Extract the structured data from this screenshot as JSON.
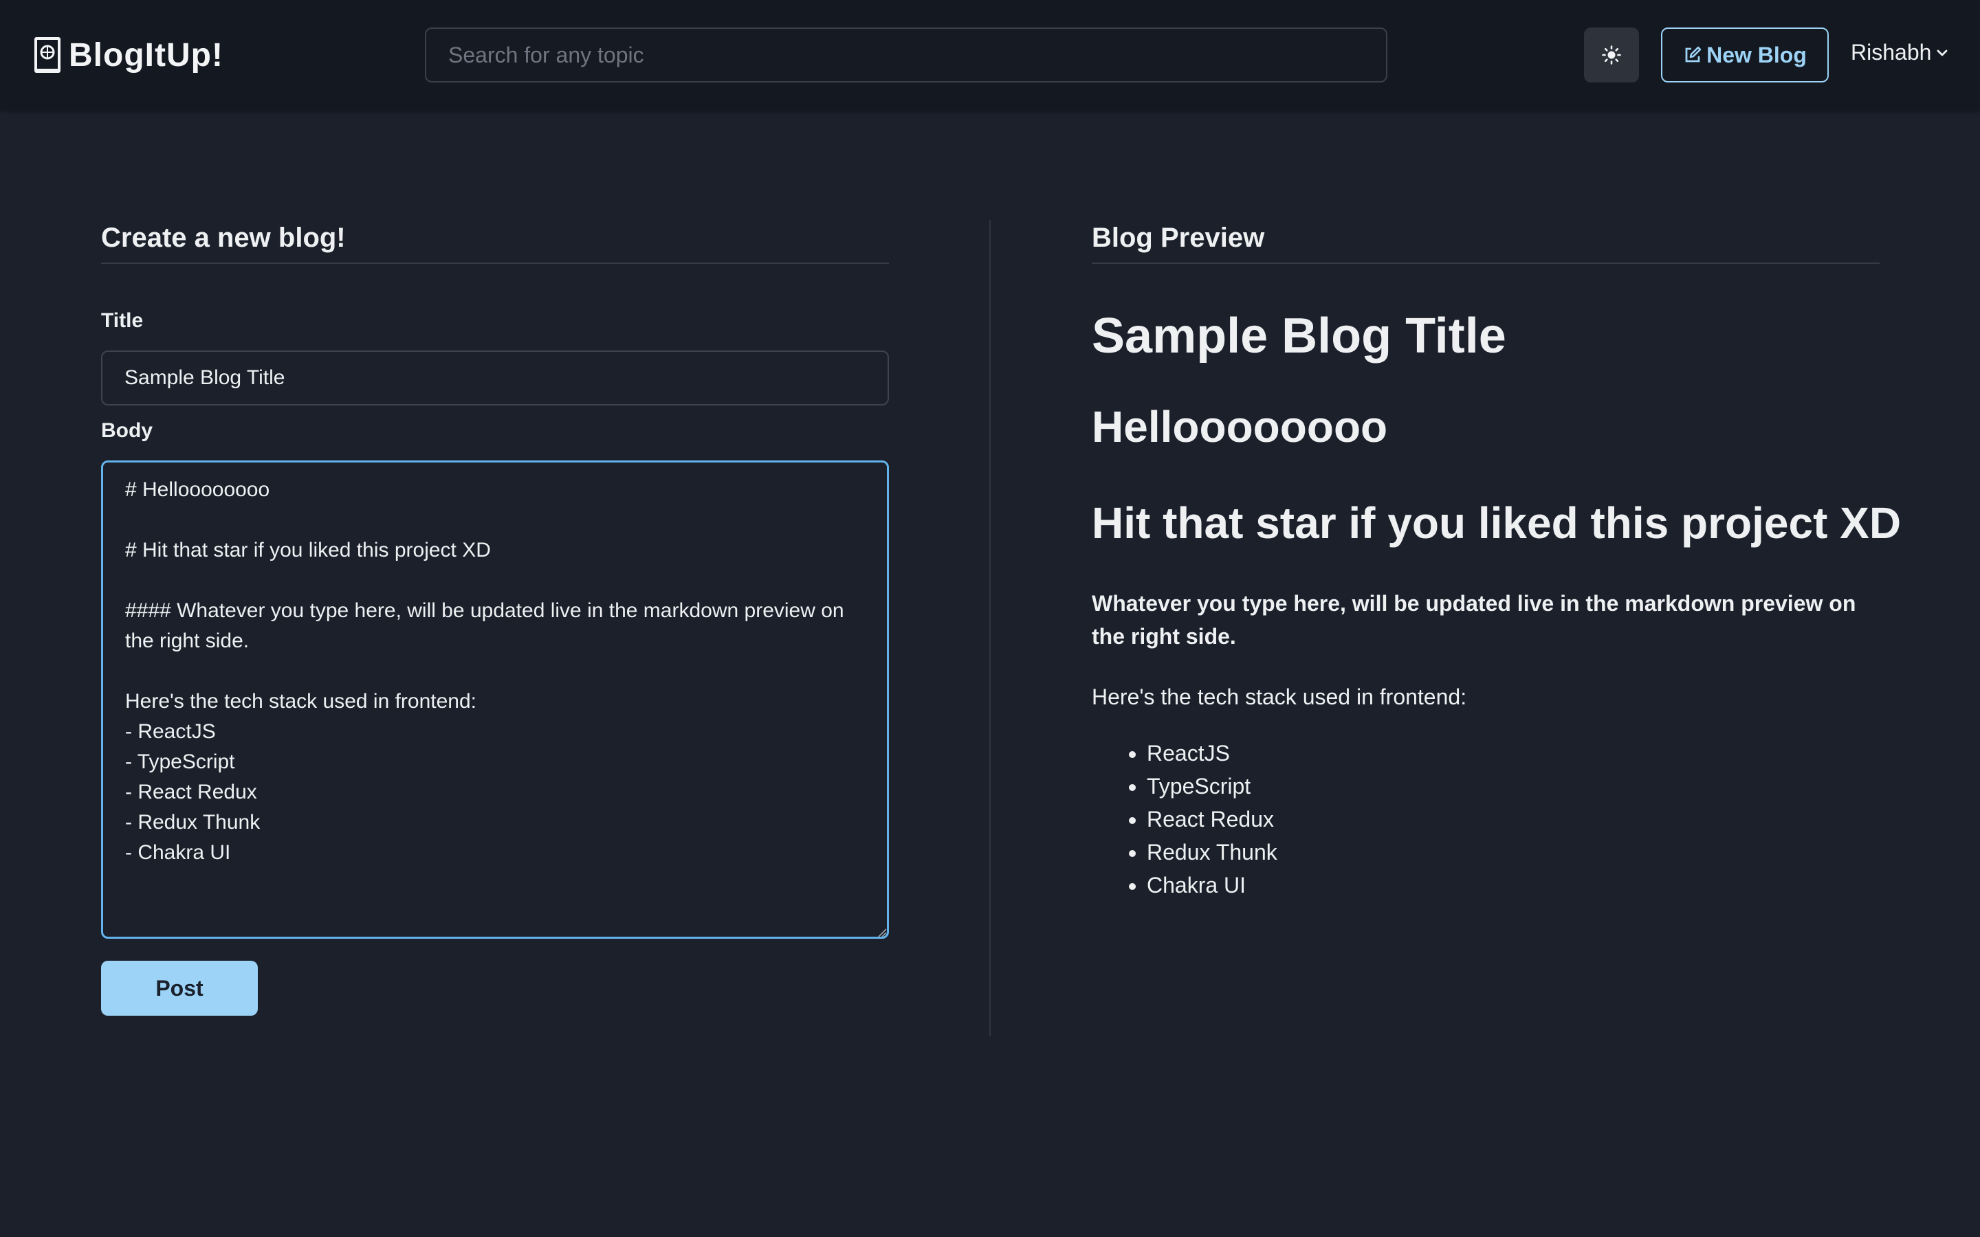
{
  "header": {
    "brand": "BlogItUp!",
    "search_placeholder": "Search for any topic",
    "theme_icon": "sun-icon",
    "new_blog_label": "New Blog",
    "user_name": "Rishabh"
  },
  "editor": {
    "heading": "Create a new blog!",
    "title_label": "Title",
    "title_value": "Sample Blog Title",
    "body_label": "Body",
    "body_value": "# Helloooooooo\n\n# Hit that star if you liked this project XD\n\n#### Whatever you type here, will be updated live in the markdown preview on the right side.\n\nHere's the tech stack used in frontend:\n- ReactJS\n- TypeScript\n- React Redux\n- Redux Thunk\n- Chakra UI",
    "post_label": "Post"
  },
  "preview": {
    "heading": "Blog Preview",
    "title": "Sample Blog Title",
    "h1_first": "Helloooooooo",
    "h1_second": "Hit that star if you liked this project XD",
    "h4": "Whatever you type here, will be updated live in the markdown preview on the right side.",
    "paragraph": "Here's the tech stack used in frontend:",
    "list": [
      "ReactJS",
      "TypeScript",
      "React Redux",
      "Redux Thunk",
      "Chakra UI"
    ]
  },
  "colors": {
    "background": "#1b202b",
    "header_bg": "#141820",
    "accent": "#9cd3f6",
    "focus_border": "#63b3ed"
  }
}
